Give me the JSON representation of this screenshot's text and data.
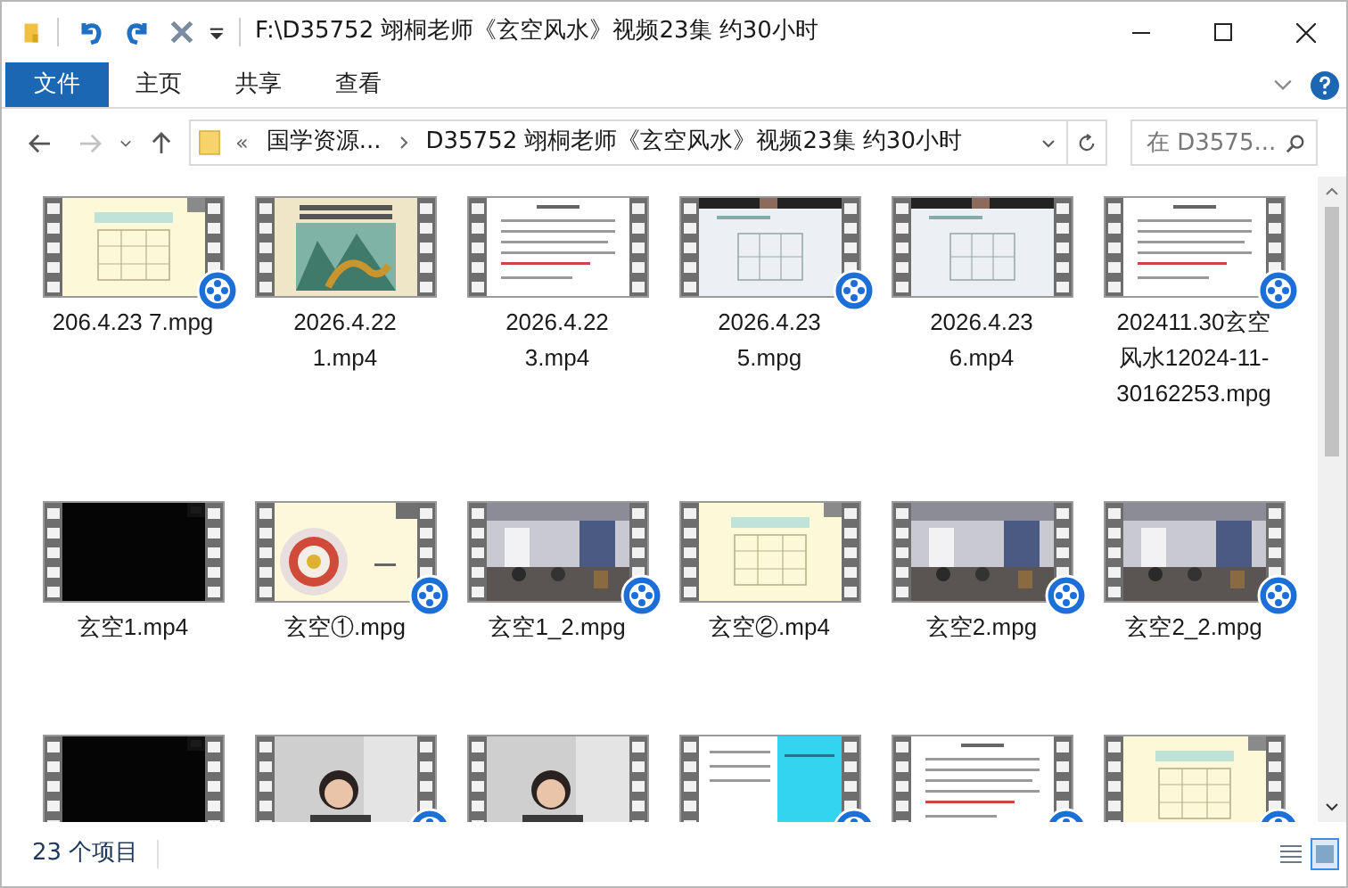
{
  "window": {
    "title": "F:\\D35752 翊桐老师《玄空风水》视频23集 约30小时"
  },
  "ribbon_tabs": [
    {
      "label": "文件",
      "selected": true
    },
    {
      "label": "主页",
      "selected": false
    },
    {
      "label": "共享",
      "selected": false
    },
    {
      "label": "查看",
      "selected": false
    }
  ],
  "navigation": {
    "back_disabled": false,
    "forward_disabled": true
  },
  "address": {
    "overflow": "«",
    "crumbs": [
      "国学资源...",
      "D35752 翊桐老师《玄空风水》视频23集 约30小时"
    ]
  },
  "search": {
    "placeholder": "在 D3575..."
  },
  "files": [
    {
      "name": "206.4.23 7.mpg",
      "kind": "grid",
      "badge": true
    },
    {
      "name": "2026.4.22 1.mp4",
      "kind": "painting",
      "badge": false
    },
    {
      "name": "2026.4.22 3.mp4",
      "kind": "document",
      "badge": false
    },
    {
      "name": "2026.4.23 5.mpg",
      "kind": "screen",
      "badge": true
    },
    {
      "name": "2026.4.23 6.mp4",
      "kind": "screen",
      "badge": false
    },
    {
      "name": "202411.30玄空风水12024-11-30162253.mpg",
      "kind": "document",
      "badge": true
    },
    {
      "name": "玄空1.mp4",
      "kind": "black",
      "badge": false
    },
    {
      "name": "玄空①.mpg",
      "kind": "wheel",
      "badge": true
    },
    {
      "name": "玄空1_2.mpg",
      "kind": "classroom",
      "badge": true
    },
    {
      "name": "玄空②.mp4",
      "kind": "grid",
      "badge": false
    },
    {
      "name": "玄空2.mpg",
      "kind": "classroom",
      "badge": true
    },
    {
      "name": "玄空2_2.mpg",
      "kind": "classroom",
      "badge": true
    },
    {
      "kind": "black",
      "badge": false
    },
    {
      "kind": "person",
      "badge": true
    },
    {
      "kind": "person",
      "badge": false
    },
    {
      "kind": "cyan",
      "badge": true
    },
    {
      "kind": "document",
      "badge": true
    },
    {
      "kind": "grid",
      "badge": true
    }
  ],
  "status_bar": {
    "item_count": "23 个项目"
  }
}
